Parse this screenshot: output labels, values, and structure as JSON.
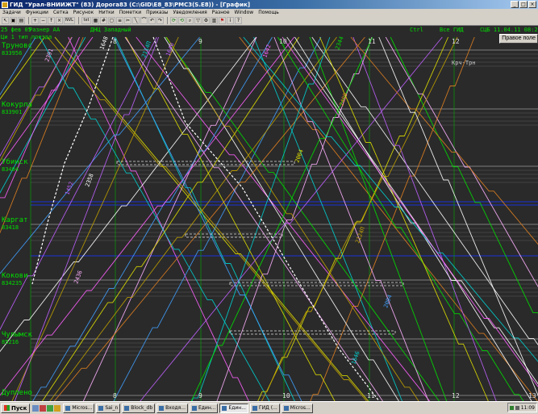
{
  "window": {
    "title": "ГИД \"Урал-ВНИИЖТ\" (83) Дорога83 (C:\\GID\\E8_83\\PMC3(S.Е8)) - [График]"
  },
  "menu": [
    "Задачи",
    "Функции",
    "Сетка",
    "Рисунок",
    "Нитки",
    "Пометки",
    "Приказы",
    "Уведомления",
    "Разное",
    "Window",
    "Помощь"
  ],
  "toolbar": {
    "nvl_label": "NVL",
    "txt_label": "txt"
  },
  "header": {
    "date": "25 фев 05",
    "mode": "Разнер А",
    "flag": "A",
    "dispatcher": "ДНЦ Западный",
    "ctrl": "Ctrl",
    "all_gid": "Все ГИД",
    "timestamp": "СЦБ 11.04.11 08:20",
    "trains_type": "Ци 1 тип поезда",
    "right_panel_button": "Правое поле"
  },
  "hours_top": [
    "8",
    "9",
    "10",
    "11",
    "12"
  ],
  "hours_bottom": [
    "8",
    "9",
    "10",
    "11",
    "12",
    "13"
  ],
  "stations": [
    {
      "name": "Труновс",
      "code": "833956"
    },
    {
      "name": "Кокурла",
      "code": "833901"
    },
    {
      "name": "Убинск",
      "code": "83404"
    },
    {
      "name": "Каргат",
      "code": "83418"
    },
    {
      "name": "Кокови",
      "code": "834235"
    },
    {
      "name": "Чулымск",
      "code": "85216"
    },
    {
      "name": "Дуплено",
      "code": ""
    }
  ],
  "train_labels": [
    "2114П",
    "1648",
    "1640",
    "2391",
    "1642",
    "2344",
    "2409",
    "2004",
    "2124П",
    "2094",
    "1646",
    "2358",
    "1452",
    "2436"
  ],
  "track_note": "Крч-Трн",
  "taskbar": {
    "start": "Пуск",
    "tasks": [
      "Micros...",
      "Sai_n",
      "Block_db",
      "Входя...",
      "Един...",
      "Един...",
      "ГИД (...",
      "Micros..."
    ],
    "clock": "11:09"
  },
  "colors": {
    "grid_green": "#00e000",
    "graph_bg": "#2a2a2a",
    "titlebar": "#0a246a"
  }
}
